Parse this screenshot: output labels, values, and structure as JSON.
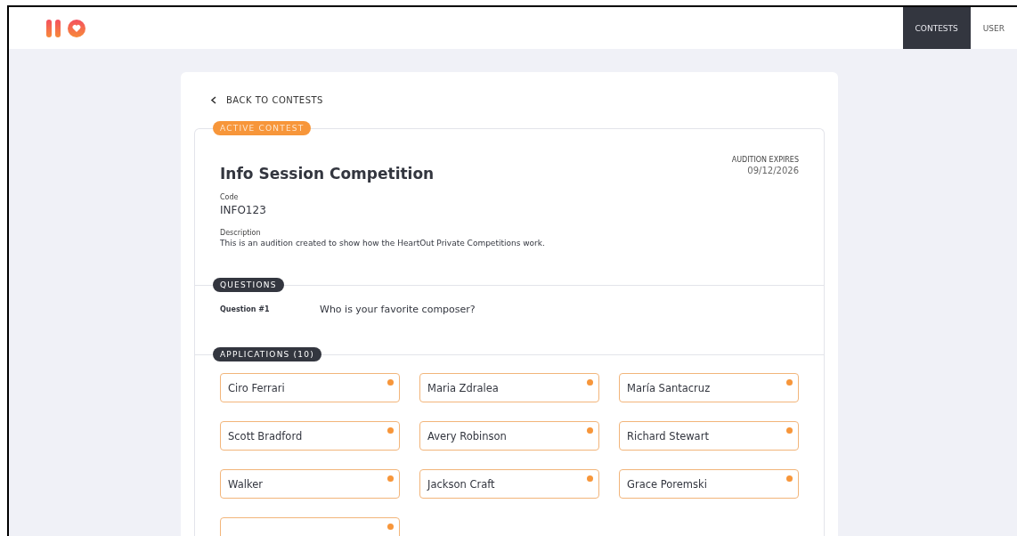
{
  "nav": {
    "items": [
      {
        "label": "CONTESTS",
        "selected": true
      },
      {
        "label": "USER",
        "selected": false
      }
    ]
  },
  "back_link": "BACK TO CONTESTS",
  "contest": {
    "status": "ACTIVE CONTEST",
    "title": "Info Session Competition",
    "expires_label": "AUDITION EXPIRES",
    "expires_date": "09/12/2026",
    "code_label": "Code",
    "code": "INFO123",
    "description_label": "Description",
    "description": "This is an audition created to show how the HeartOut Private Competitions work."
  },
  "questions": {
    "heading": "QUESTIONS",
    "items": [
      {
        "label": "Question #1",
        "text": "Who is your favorite composer?"
      }
    ]
  },
  "applications": {
    "heading": "APPLICATIONS (10)",
    "items": [
      {
        "kind": "named",
        "name": "Ciro Ferrari"
      },
      {
        "kind": "named",
        "name": "Maria Zdralea"
      },
      {
        "kind": "named",
        "name": "María Santacruz"
      },
      {
        "kind": "named",
        "name": "Scott Bradford"
      },
      {
        "kind": "named",
        "name": "Avery Robinson"
      },
      {
        "kind": "named",
        "name": "Richard Stewart"
      },
      {
        "kind": "named",
        "name": "Walker"
      },
      {
        "kind": "named",
        "name": "Jackson Craft"
      },
      {
        "kind": "named",
        "name": "Grace Poremski"
      },
      {
        "kind": "cut-off"
      }
    ]
  }
}
